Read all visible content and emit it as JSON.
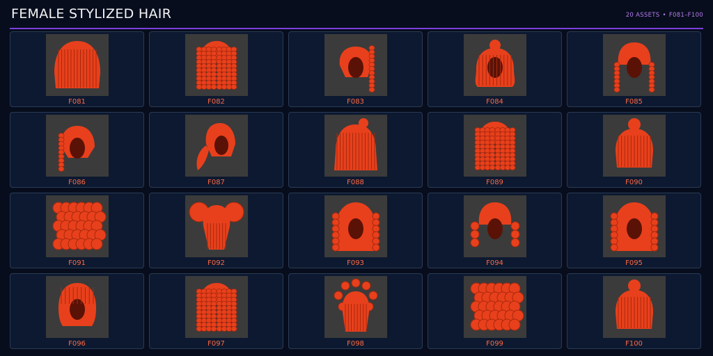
{
  "header": {
    "title": "FEMALE STYLIZED HAIR",
    "asset_count": "20 ASSETS",
    "separator": "•",
    "range": "F081–F100"
  },
  "colors": {
    "background": "#070d1c",
    "card": "#0d1930",
    "card_border": "#2a3b57",
    "accent_rule": "#7c3fe0",
    "meta_text": "#b77bf0",
    "label_text": "#ff6a45",
    "hair": "#e8401c",
    "thumb_bg": "#3b3b3b"
  },
  "assets": [
    {
      "code": "F081",
      "style": "straight-bob"
    },
    {
      "code": "F082",
      "style": "braids"
    },
    {
      "code": "F083",
      "style": "side-ponytail"
    },
    {
      "code": "F084",
      "style": "top-bun-wavy"
    },
    {
      "code": "F085",
      "style": "twin-braids"
    },
    {
      "code": "F086",
      "style": "side-braid"
    },
    {
      "code": "F087",
      "style": "low-ponytail"
    },
    {
      "code": "F088",
      "style": "top-knot-long"
    },
    {
      "code": "F089",
      "style": "braids"
    },
    {
      "code": "F090",
      "style": "top-bun-bob"
    },
    {
      "code": "F091",
      "style": "curly-afro"
    },
    {
      "code": "F092",
      "style": "puffs"
    },
    {
      "code": "F093",
      "style": "curly-long"
    },
    {
      "code": "F094",
      "style": "bubble-pigtails"
    },
    {
      "code": "F095",
      "style": "curly-long"
    },
    {
      "code": "F096",
      "style": "twists-short"
    },
    {
      "code": "F097",
      "style": "braids"
    },
    {
      "code": "F098",
      "style": "bantu-knots"
    },
    {
      "code": "F099",
      "style": "curly-afro"
    },
    {
      "code": "F100",
      "style": "top-bun-bob"
    }
  ]
}
